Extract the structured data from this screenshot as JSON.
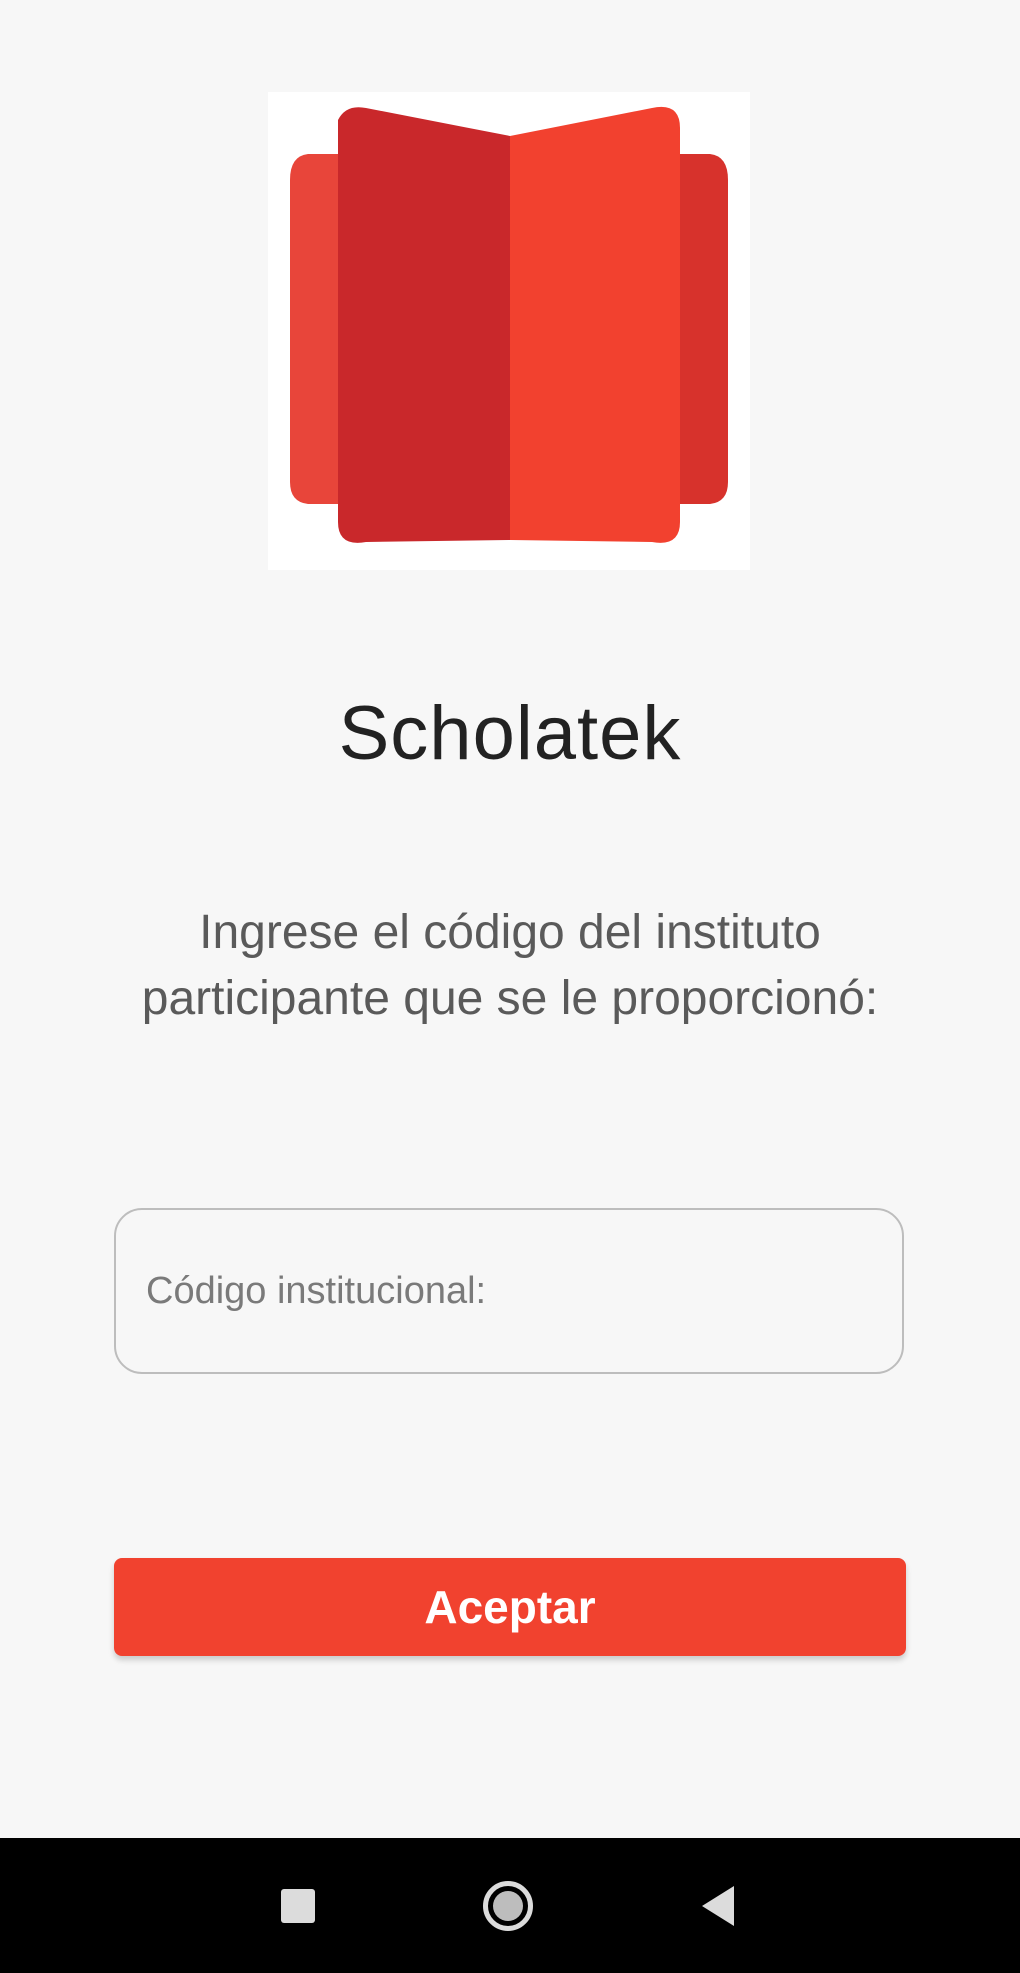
{
  "app": {
    "title": "Scholatek"
  },
  "prompt": {
    "text": "Ingrese el código del instituto participante que se le proporcionó:"
  },
  "code_field": {
    "placeholder": "Código institucional:",
    "value": ""
  },
  "accept_button": {
    "label": "Aceptar"
  },
  "icons": {
    "logo": "open-book-icon",
    "nav_recents": "square-icon",
    "nav_home": "circle-icon",
    "nav_back": "triangle-back-icon"
  },
  "colors": {
    "accent": "#f1422f",
    "logo_dark": "#c9282b",
    "logo_light": "#f2412f",
    "background": "#f7f7f7"
  }
}
